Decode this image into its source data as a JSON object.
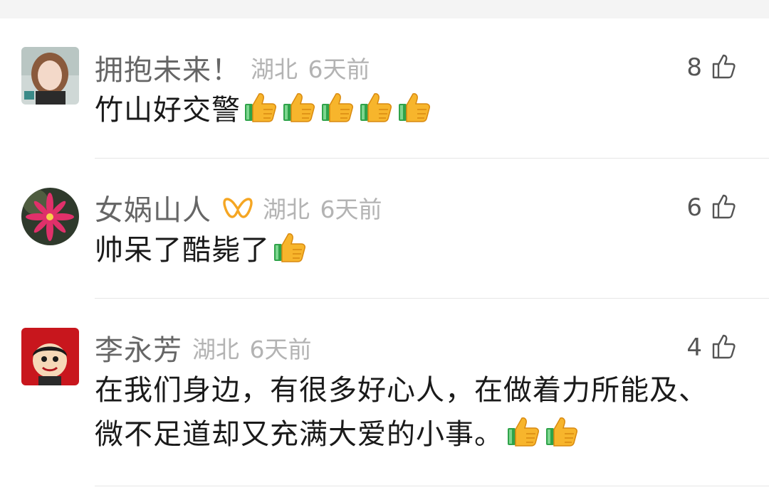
{
  "comments": [
    {
      "username": "拥抱未来！",
      "location": "湖北",
      "time": "6天前",
      "likes": "8",
      "text": "竹山好交警",
      "thumbs_up_emoji_count": 5,
      "has_badge": false,
      "avatar_shape": "square"
    },
    {
      "username": "女娲山人",
      "location": "湖北",
      "time": "6天前",
      "likes": "6",
      "text": "帅呆了酷毙了",
      "thumbs_up_emoji_count": 1,
      "has_badge": true,
      "avatar_shape": "round"
    },
    {
      "username": "李永芳",
      "location": "湖北",
      "time": "6天前",
      "likes": "4",
      "text": "在我们身边，有很多好心人，在做着力所能及、微不足道却又充满大爱的小事。",
      "thumbs_up_emoji_count": 2,
      "has_badge": false,
      "avatar_shape": "square"
    }
  ],
  "icons": {
    "like": "thumbs-up-outline-icon",
    "emoji": "thumbs-up-emoji",
    "badge": "vip-ribbon-icon"
  },
  "colors": {
    "meta_text": "#b3b3b3",
    "username": "#666666",
    "badge": "#f5a623",
    "divider": "#e6e6e6"
  }
}
